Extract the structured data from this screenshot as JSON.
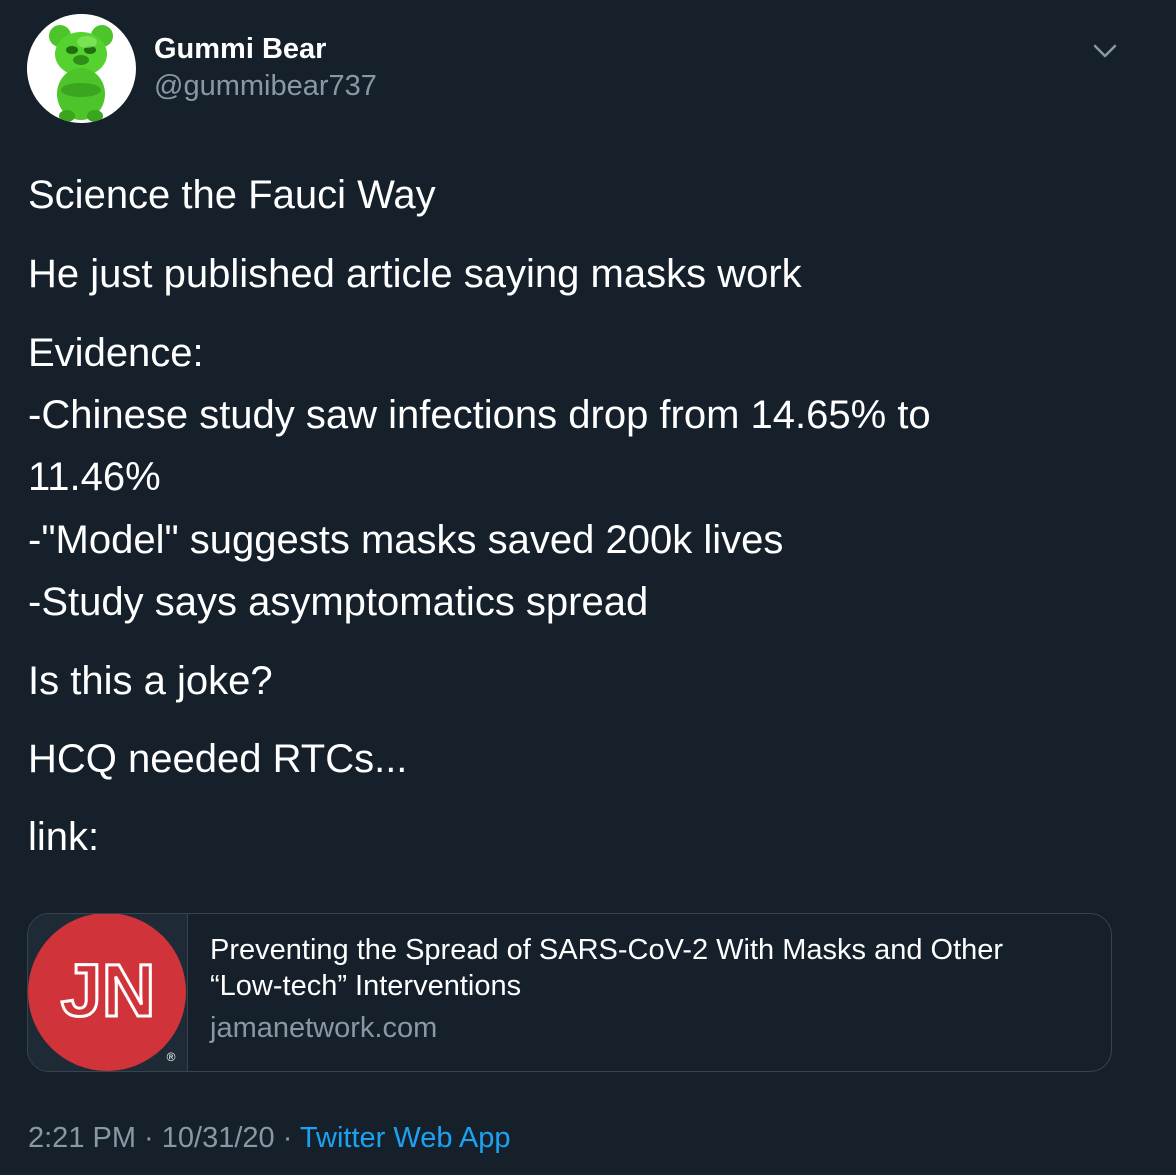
{
  "author": {
    "display_name": "Gummi Bear",
    "handle": "@gummibear737",
    "avatar_icon": "green-bear-avatar"
  },
  "tweet": {
    "lines": [
      "Science the Fauci Way",
      "He just published article saying masks work",
      "Evidence:",
      "-Chinese study saw infections drop from 14.65% to",
      "11.46%",
      "-\"Model\" suggests masks saved 200k lives",
      "-Study says asymptomatics spread",
      "Is this a joke?",
      "HCQ needed RTCs...",
      "link:"
    ]
  },
  "link_card": {
    "logo_text": "JN",
    "logo_mark": "®",
    "logo_color": "#d0343a",
    "title_line1": "Preventing the Spread of SARS-CoV-2 With Masks and Other",
    "title_line2": "“Low-tech” Interventions",
    "domain": "jamanetwork.com"
  },
  "meta": {
    "time": "2:21 PM",
    "separator": " · ",
    "date": "10/31/20",
    "source": "Twitter Web App"
  },
  "colors": {
    "background": "#15202b",
    "secondary_text": "#8899a6",
    "link": "#1da1f2",
    "border": "#38444d"
  }
}
